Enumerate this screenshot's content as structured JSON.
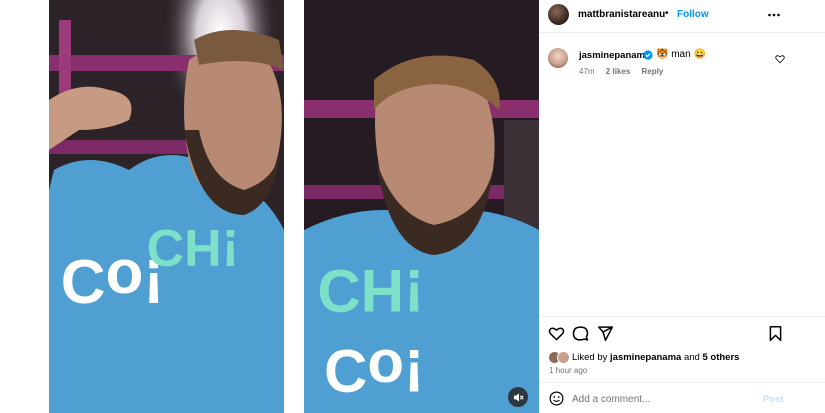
{
  "post": {
    "author": "mattbranistareanu",
    "dot": "•",
    "follow_label": "Follow",
    "liked_by_user": "jasminepanama",
    "liked_by_prefix": "Liked by",
    "liked_by_and": "and",
    "liked_by_others": "5 others",
    "timestamp": "1 hour ago"
  },
  "comment": {
    "user": "jasminepanama",
    "text": "🐯 man 😀",
    "age": "47m",
    "likes": "2 likes",
    "reply_label": "Reply"
  },
  "composer": {
    "placeholder": "Add a comment...",
    "post_label": "Post"
  },
  "icons": {
    "more": "more-horizontal-icon",
    "verified": "verified-badge-icon",
    "heart": "heart-icon",
    "comment": "comment-icon",
    "share": "share-icon",
    "save": "bookmark-icon",
    "emoji": "emoji-icon",
    "mute": "audio-muted-icon"
  },
  "colors": {
    "follow": "#0095f6",
    "verified": "#0095f6",
    "muted_text": "#737373",
    "post_disabled": "#c7e0f4"
  }
}
